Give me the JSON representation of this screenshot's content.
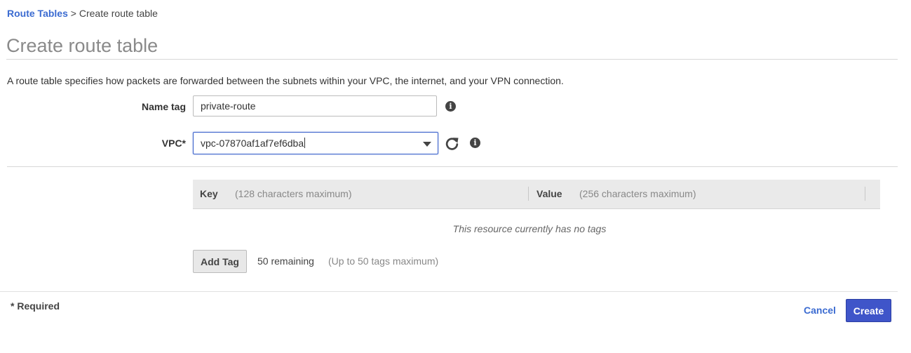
{
  "breadcrumb": {
    "parent": "Route Tables",
    "separator": " > ",
    "current": "Create route table"
  },
  "page": {
    "title": "Create route table",
    "description": "A route table specifies how packets are forwarded between the subnets within your VPC, the internet, and your VPN connection."
  },
  "form": {
    "name_tag": {
      "label": "Name tag",
      "value": "private-route"
    },
    "vpc": {
      "label": "VPC*",
      "value": "vpc-07870af1af7ef6dba"
    }
  },
  "icons": {
    "info": "i",
    "refresh": "refresh-icon",
    "dropdown": "chevron-down-icon"
  },
  "tags": {
    "key_header": "Key",
    "key_hint": "(128 characters maximum)",
    "value_header": "Value",
    "value_hint": "(256 characters maximum)",
    "empty_message": "This resource currently has no tags",
    "add_button": "Add Tag",
    "remaining": "50 remaining",
    "max_hint": "(Up to 50 tags maximum)"
  },
  "footer": {
    "required_note": "* Required",
    "cancel_label": "Cancel",
    "create_label": "Create"
  },
  "colors": {
    "link": "#3b6bd1",
    "primary_button": "#3f55c9",
    "focus_border": "#3b62cc"
  }
}
